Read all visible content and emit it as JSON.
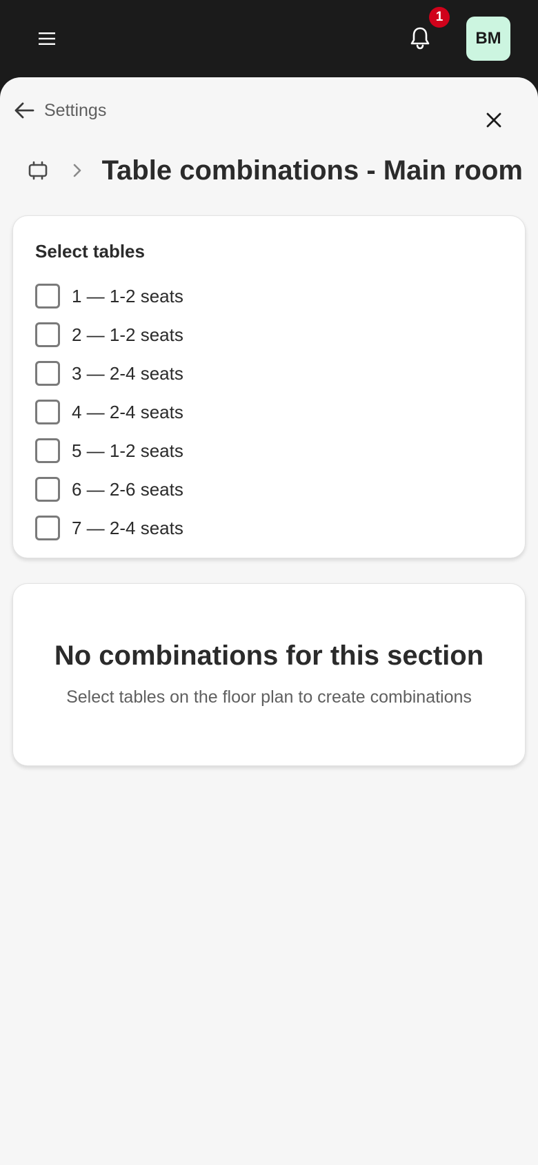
{
  "topbar": {
    "menu_icon": "hamburger-menu-icon",
    "bell_icon": "bell-icon",
    "notification_count": "1",
    "avatar_initials": "BM",
    "colors": {
      "bar": "#1b1b1b",
      "badge": "#d0021b",
      "avatar_bg": "#ccf5e0"
    }
  },
  "header": {
    "back_label": "Settings",
    "back_icon": "arrow-left-icon",
    "close_icon": "close-icon",
    "breadcrumb_icon": "floor-plan-icon",
    "breadcrumb_separator_icon": "chevron-right-icon",
    "title": "Table combinations - Main room"
  },
  "tables_card": {
    "heading": "Select tables",
    "items": [
      {
        "label": "1 — 1-2 seats",
        "checked": false
      },
      {
        "label": "2 — 1-2 seats",
        "checked": false
      },
      {
        "label": "3 — 2-4 seats",
        "checked": false
      },
      {
        "label": "4 — 2-4 seats",
        "checked": false
      },
      {
        "label": "5 — 1-2 seats",
        "checked": false
      },
      {
        "label": "6 — 2-6 seats",
        "checked": false
      },
      {
        "label": "7 — 2-4 seats",
        "checked": false
      }
    ]
  },
  "empty_state": {
    "title": "No combinations for this section",
    "subtitle": "Select tables on the floor plan to create combinations"
  }
}
